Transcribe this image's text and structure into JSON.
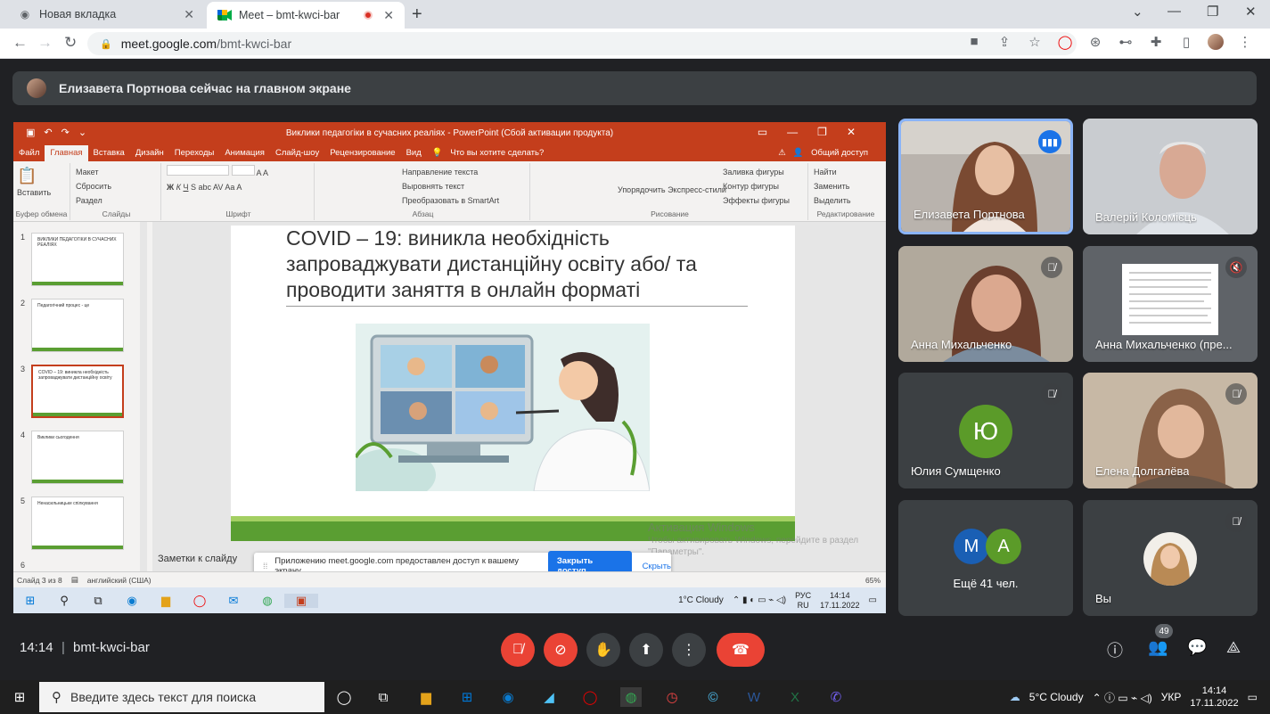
{
  "browser": {
    "tabs": [
      {
        "title": "Новая вкладка",
        "icon": "chrome-icon"
      },
      {
        "title": "Meet – bmt-kwci-bar",
        "icon": "meet-icon",
        "recording": true
      }
    ],
    "url_host": "meet.google.com",
    "url_path": "/bmt-kwci-bar"
  },
  "meet": {
    "presenter_notice": "Елизавета Портнова сейчас на главном экране",
    "time": "14:14",
    "meeting_code": "bmt-kwci-bar",
    "participants_count": "49",
    "participants": [
      {
        "name": "Елизавета Портнова",
        "state": "speaking"
      },
      {
        "name": "Валерій Коломієць",
        "state": "video"
      },
      {
        "name": "Анна Михальченко",
        "state": "muted"
      },
      {
        "name": "Анна Михальченко (пре...",
        "state": "muted"
      },
      {
        "name": "Юлия Сумщенко",
        "initial": "Ю",
        "state": "muted"
      },
      {
        "name": "Елена Долгалёва",
        "state": "muted"
      },
      {
        "name": "Ещё 41 чел.",
        "initials": [
          "М",
          "А"
        ]
      },
      {
        "name": "Вы",
        "state": "muted"
      }
    ]
  },
  "ppt": {
    "window_title": "Виклики педагогіки в сучасних реаліях - PowerPoint (Сбой активации продукта)",
    "menu": [
      "Файл",
      "Главная",
      "Вставка",
      "Дизайн",
      "Переходы",
      "Анимация",
      "Слайд-шоу",
      "Рецензирование",
      "Вид",
      "Что вы хотите сделать?",
      "Общий доступ"
    ],
    "ribbon": {
      "clipboard": {
        "paste": "Вставить",
        "label": "Буфер обмена"
      },
      "slides": {
        "create": "Создать слайд",
        "layout": "Макет",
        "reset": "Сбросить",
        "section": "Раздел",
        "label": "Слайды"
      },
      "font": {
        "label": "Шрифт"
      },
      "paragraph": {
        "dir": "Направление текста",
        "align": "Выровнять текст",
        "smartart": "Преобразовать в SmartArt",
        "label": "Абзац"
      },
      "drawing": {
        "arrange": "Упорядочить",
        "styles": "Экспресс-стили",
        "fill": "Заливка фигуры",
        "outline": "Контур фигуры",
        "effects": "Эффекты фигуры",
        "label": "Рисование"
      },
      "editing": {
        "find": "Найти",
        "replace": "Заменить",
        "select": "Выделить",
        "label": "Редактирование"
      }
    },
    "slide_title": "COVID – 19: виникла необхідність запроваджувати дистанційну освіту або/ та проводити заняття в онлайн форматі",
    "thumbnails": [
      {
        "num": "1",
        "text": "ВИКЛИКИ ПЕДАГОГІКИ В СУЧАСНИХ РЕАЛІЯХ"
      },
      {
        "num": "2",
        "text": "Педагогічний процес - це"
      },
      {
        "num": "3",
        "text": "COVID – 19: виникла необхідність запроваджувати дистанційну освіту"
      },
      {
        "num": "4",
        "text": "Виклики сьогодення"
      },
      {
        "num": "5",
        "text": "Ненасильницьке спілкування"
      },
      {
        "num": "6",
        "text": ""
      }
    ],
    "notes_label": "Заметки к слайду",
    "status": {
      "slide": "Слайд 3 из 8",
      "lang": "английский (США)",
      "zoom": "65%"
    },
    "share_notice": "Приложению meet.google.com предоставлен доступ к вашему экрану.",
    "stop_share": "Закрыть доступ",
    "hide": "Скрыть",
    "watermark_title": "Активация Windows",
    "watermark_text": "Чтобы активировать Windows, перейдите в раздел \"Параметры\".",
    "inner_taskbar": {
      "weather": "1°C  Cloudy",
      "lang": "РУС",
      "lang2": "RU",
      "time": "14:14",
      "date": "17.11.2022"
    }
  },
  "taskbar": {
    "search_placeholder": "Введите здесь текст для поиска",
    "weather": "5°C  Cloudy",
    "lang": "УКР",
    "time": "14:14",
    "date": "17.11.2022"
  }
}
